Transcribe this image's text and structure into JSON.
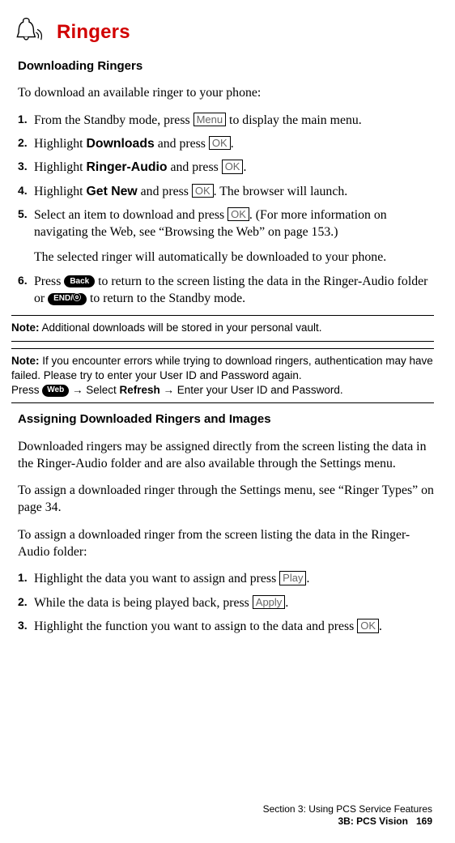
{
  "header": {
    "title": "Ringers"
  },
  "section1": {
    "heading": "Downloading Ringers",
    "intro": "To download an available ringer to your phone:",
    "steps": [
      {
        "n": "1.",
        "pre": "From the Standby mode, press ",
        "key": "Menu",
        "post": " to display the main menu."
      },
      {
        "n": "2.",
        "pre": "Highlight ",
        "bold": "Downloads",
        "mid": " and press ",
        "key": "OK",
        "post": "."
      },
      {
        "n": "3.",
        "pre": "Highlight ",
        "bold": "Ringer-Audio",
        "mid": " and press ",
        "key": "OK",
        "post": "."
      },
      {
        "n": "4.",
        "pre": "Highlight ",
        "bold": "Get New",
        "mid": " and press ",
        "key": "OK",
        "post": ". The browser will launch."
      },
      {
        "n": "5.",
        "pre": "Select an item to download and press ",
        "key": "OK",
        "post": ". (For more information on navigating the Web, see “Browsing the Web” on page 153.)",
        "follow": "The selected ringer will automatically be downloaded to your phone."
      },
      {
        "n": "6.",
        "pre": "Press ",
        "pill1": "Back",
        "mid1": " to return to the screen listing the data in the Ringer-Audio folder or ",
        "pill2": "END/ⓞ",
        "post": " to return to the Standby mode."
      }
    ]
  },
  "note1": {
    "label": "Note:",
    "text": " Additional downloads will be stored in your personal vault."
  },
  "note2": {
    "label": "Note:",
    "text": " If you encounter errors while trying to download ringers, authentication may have failed. Please try to enter your User ID and Password again.",
    "line2_a": "Press ",
    "pill": "Web",
    "line2_b": " → Select ",
    "bold": "Refresh",
    "line2_c": " → Enter your User ID and Password."
  },
  "section2": {
    "heading": "Assigning Downloaded Ringers and Images",
    "p1": "Downloaded ringers may be assigned directly from the screen listing the data in the Ringer-Audio folder and are also available through the Settings menu.",
    "p2": "To assign a downloaded ringer through the Settings menu, see “Ringer Types” on page 34.",
    "p3": "To assign a downloaded ringer from the screen listing the data in the Ringer-Audio folder:",
    "steps": [
      {
        "n": "1.",
        "pre": "Highlight the data you want to assign and press ",
        "key": "Play",
        "post": "."
      },
      {
        "n": "2.",
        "pre": "While the data is being played back, press ",
        "key": "Apply",
        "post": "."
      },
      {
        "n": "3.",
        "pre": "Highlight the function you want to assign to the data and press ",
        "key": "OK",
        "post": "."
      }
    ]
  },
  "footer": {
    "line1": "Section 3: Using PCS Service Features",
    "line2a": "3B: PCS Vision",
    "page": "169"
  }
}
